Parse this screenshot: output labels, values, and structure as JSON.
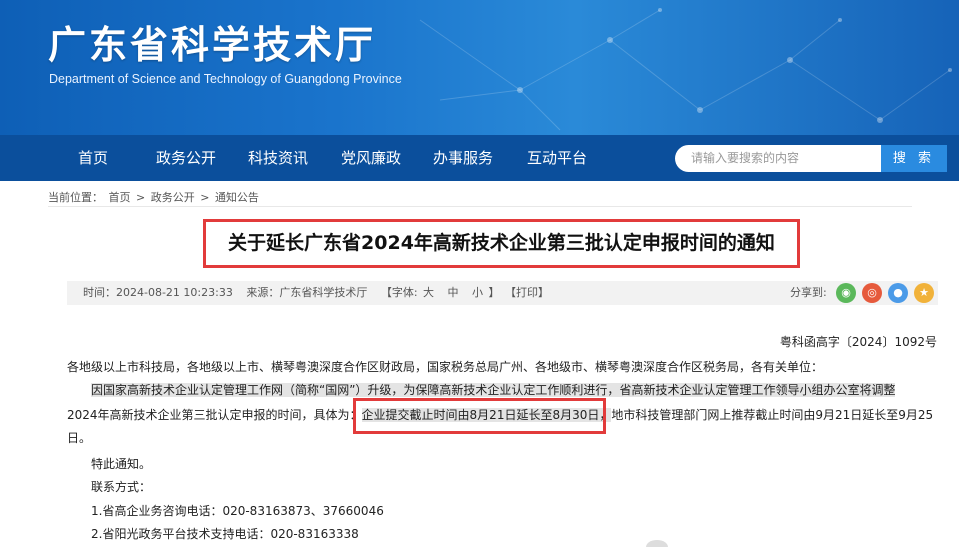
{
  "header": {
    "title": "广东省科学技术厅",
    "subtitle": "Department of Science and Technology of Guangdong Province"
  },
  "nav": {
    "items": [
      "首页",
      "政务公开",
      "科技资讯",
      "党风廉政",
      "办事服务",
      "互动平台"
    ]
  },
  "search": {
    "placeholder": "请输入要搜索的内容",
    "button_label": "搜 索"
  },
  "breadcrumb": {
    "label": "当前位置：",
    "items": [
      "首页",
      "政务公开",
      "通知公告"
    ],
    "separator": ">"
  },
  "article": {
    "title": "关于延长广东省2024年高新技术企业第三批认定申报时间的通知",
    "meta": {
      "time": "时间：2024-08-21 10:23:33",
      "source": "来源：广东省科学技术厅",
      "font_label": "【字体:",
      "font_large": "大",
      "font_medium": "中",
      "font_small": "小",
      "font_close": "】",
      "print": "【打印】",
      "share_label": "分享到:"
    },
    "doc_number": "粤科函高字〔2024〕1092号",
    "addressee": "各地级以上市科技局，各地级以上市、横琴粤澳深度合作区财政局，国家税务总局广州、各地级市、横琴粤澳深度合作区税务局，各有关单位：",
    "para1_line1": "因国家高新技术企业认定管理工作网（简称“国网”）升级，为保障高新技术企业认定工作顺利进行，省高新技术企业认定管理工作领导小组办公室将调整",
    "para1_line2_a": "2024年高新技术企业第三批认定申报的时间，具体为：",
    "para1_line2_b": "企业提交截止时间由8月21日延长至8月30日，",
    "para1_line2_c": "地市科技管理部门网上推荐截止时间由9月21日延长至9月25",
    "para1_line3": "日。",
    "notice": "特此通知。",
    "contact_label": "联系方式：",
    "contact1": "1.省高企业务咨询电话：020-83163873、37660046",
    "contact2": "2.省阳光政务平台技术支持电话：020-83163338"
  },
  "colors": {
    "banner": "#1a74cc",
    "nav": "#0b4f9c",
    "search_button": "#2a8be0",
    "highlight_box": "#e23b3b"
  },
  "share_icons": [
    "wechat-icon",
    "weibo-icon",
    "qq-icon",
    "qzone-icon"
  ]
}
